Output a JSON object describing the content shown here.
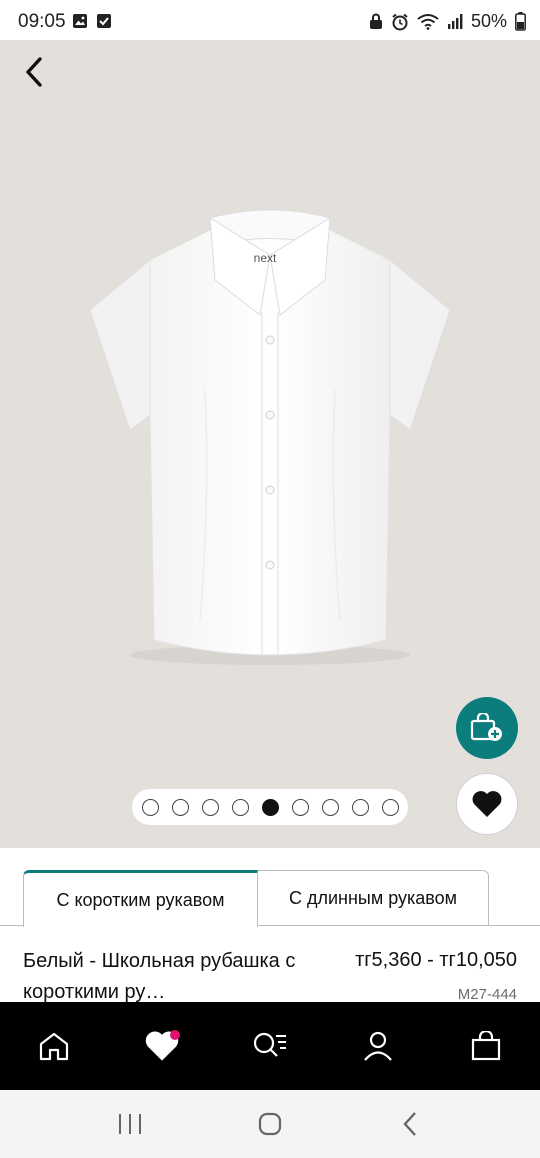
{
  "status_bar": {
    "time": "09:05",
    "battery_text": "50%",
    "left_icons": [
      "gallery-icon",
      "checkbox-icon"
    ],
    "right_icons": [
      "lock-icon",
      "alarm-icon",
      "wifi-icon",
      "signal-icon",
      "battery-icon"
    ]
  },
  "hero": {
    "image_alt": "white short sleeve school shirt",
    "brand_label": "next",
    "carousel": {
      "count": 9,
      "active_index": 4
    }
  },
  "tabs": [
    {
      "label": "С коротким рукавом",
      "active": true
    },
    {
      "label": "С длинным рукавом",
      "active": false
    }
  ],
  "product": {
    "title": "Белый - Школьная рубашка с короткими ру…",
    "price": "тг5,360 - тг10,050",
    "code": "M27-444"
  },
  "bottom_nav": {
    "items": [
      "home-icon",
      "heart-icon",
      "search-list-icon",
      "account-icon",
      "bag-icon"
    ],
    "badge_color": "#e0106e"
  },
  "colors": {
    "accent": "#0c7d7d",
    "hero_background": "#e3e0dc"
  }
}
